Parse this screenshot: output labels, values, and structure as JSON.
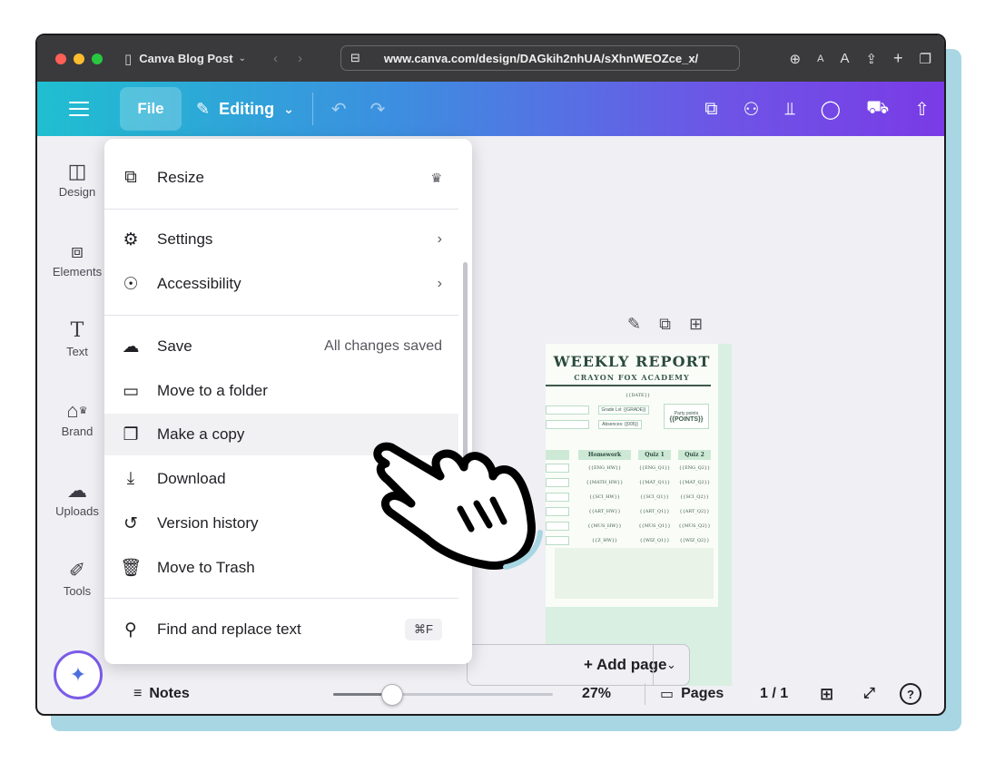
{
  "browser": {
    "tab_title": "Canva Blog Post",
    "url": "www.canva.com/design/DAGkih2nhUA/sXhnWEOZce_x/"
  },
  "toolbar": {
    "file_label": "File",
    "editing_label": "Editing"
  },
  "sidebar": {
    "items": [
      {
        "label": "Design"
      },
      {
        "label": "Elements"
      },
      {
        "label": "Text"
      },
      {
        "label": "Brand"
      },
      {
        "label": "Uploads"
      },
      {
        "label": "Tools"
      }
    ]
  },
  "file_menu": {
    "resize": "Resize",
    "settings": "Settings",
    "accessibility": "Accessibility",
    "save": "Save",
    "save_status": "All changes saved",
    "move_folder": "Move to a folder",
    "make_copy": "Make a copy",
    "download": "Download",
    "version_history": "Version history",
    "move_trash": "Move to Trash",
    "find_replace": "Find and replace text",
    "find_shortcut": "⌘F"
  },
  "document": {
    "title": "WEEKLY REPORT",
    "subtitle": "CRAYON FOX ACADEMY",
    "date_field": "{{DATE}}",
    "grade_field": "Grade Lvl: {{GRADE}}",
    "absences_field": "Absences: {{005}}",
    "party_points_label": "Party points",
    "points_field": "{{POINTS}}",
    "col_homework": "Homework",
    "col_quiz1": "Quiz 1",
    "col_quiz2": "Quiz 2",
    "rows": [
      {
        "hw": "{{ENG_HW}}",
        "q1": "{{ENG_Q1}}",
        "q2": "{{ENG_Q2}}"
      },
      {
        "hw": "{{MATH_HW}}",
        "q1": "{{MAT_Q1}}",
        "q2": "{{MAT_Q2}}"
      },
      {
        "hw": "{{SCI_HW}}",
        "q1": "{{SCI_Q1}}",
        "q2": "{{SCI_Q2}}"
      },
      {
        "hw": "{{ART_HW}}",
        "q1": "{{ART_Q1}}",
        "q2": "{{ART_Q2}}"
      },
      {
        "hw": "{{MUS_HW}}",
        "q1": "{{MUS_Q1}}",
        "q2": "{{MUS_Q2}}"
      },
      {
        "hw": "{{Z_HW}}",
        "q1": "{{WIZ_Q1}}",
        "q2": "{{WIZ_Q2}}"
      }
    ]
  },
  "canvas": {
    "add_page_label": "+ Add page"
  },
  "bottom": {
    "notes_label": "Notes",
    "zoom_label": "27%",
    "zoom_fraction": 0.27,
    "pages_label": "Pages",
    "page_count": "1 / 1"
  },
  "colors": {
    "toolbar_gradient_start": "#1fbfd0",
    "toolbar_gradient_end": "#7a3be6",
    "accent": "#7b5be8"
  },
  "icons": [
    "hamburger-icon",
    "pencil-icon",
    "undo-icon",
    "redo-icon",
    "resize-icon",
    "share-people-icon",
    "chart-icon",
    "comment-icon",
    "truck-icon",
    "upload-icon",
    "crown-icon",
    "gear-icon",
    "accessibility-icon",
    "cloud-check-icon",
    "folder-icon",
    "copy-icon",
    "download-icon",
    "history-icon",
    "trash-icon",
    "search-icon",
    "sparkle-icon",
    "pointing-hand-icon"
  ]
}
